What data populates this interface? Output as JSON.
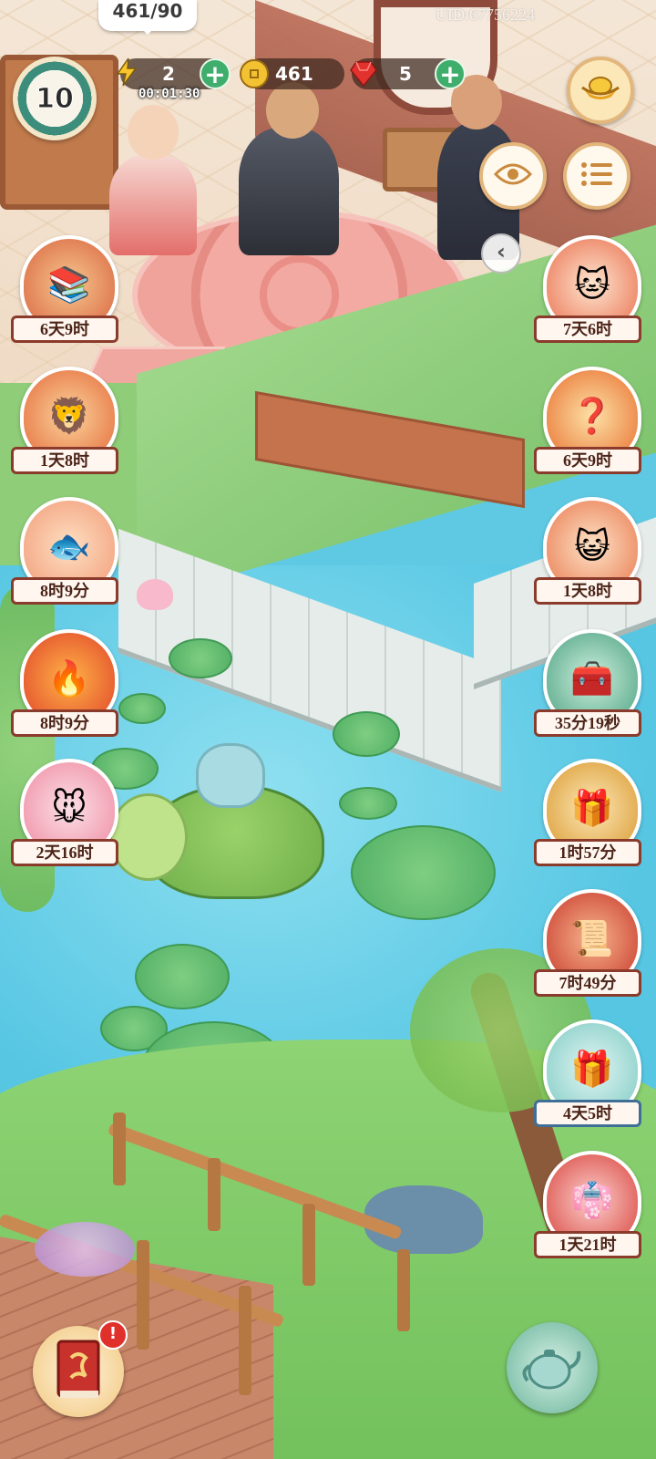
{
  "hud": {
    "bubble_text": "461/90",
    "level": "10",
    "energy": {
      "value": "2",
      "timer": "00:01:30",
      "icon": "lightning-icon"
    },
    "coins": {
      "value": "461",
      "icon": "coin-icon"
    },
    "gems": {
      "value": "5",
      "icon": "ruby-icon"
    },
    "plus_symbol": "+",
    "uid": "UID:67756224",
    "chevron_symbol": "‹"
  },
  "left_events": [
    {
      "id": "book-bundle",
      "icon": "book-bundle-icon",
      "time": "6天9时"
    },
    {
      "id": "lion-pet",
      "icon": "lion-pet-icon",
      "time": "1天8时"
    },
    {
      "id": "koi-fish",
      "icon": "koi-fish-icon",
      "time": "8时9分"
    },
    {
      "id": "fire-orb",
      "icon": "fire-orb-icon",
      "time": "8时9分"
    },
    {
      "id": "mouse-pet",
      "icon": "mouse-pet-icon",
      "time": "2天16时"
    }
  ],
  "right_events": [
    {
      "id": "cat-mask",
      "icon": "cat-mask-icon",
      "time": "7天6时"
    },
    {
      "id": "mystery-box",
      "icon": "mystery-box-icon",
      "time": "6天9时"
    },
    {
      "id": "lucky-cat",
      "icon": "lucky-cat-icon",
      "time": "1天8时"
    },
    {
      "id": "treasure-chest",
      "icon": "treasure-chest-icon",
      "time": "35分19秒"
    },
    {
      "id": "golden-gift",
      "icon": "golden-gift-icon",
      "time": "1时57分"
    },
    {
      "id": "plus-one-scroll",
      "icon": "plus-one-scroll-icon",
      "time": "7时49分"
    },
    {
      "id": "jade-gift",
      "icon": "jade-gift-icon",
      "time": "4天5时"
    },
    {
      "id": "lady-character",
      "icon": "lady-character-icon",
      "time": "1天21时"
    }
  ],
  "buttons": {
    "eye": "eye-icon",
    "menu": "menu-list-icon",
    "gold-ingot": "gold-ingot-icon",
    "journal": "red-journal-icon",
    "journal_alert": "!",
    "teapot": "teapot-icon"
  },
  "colors": {
    "label_border": "#8a3b2c",
    "label_border_blue": "#3f6f96",
    "plus_green": "#3fae6c",
    "water": "#5fc9e4"
  }
}
